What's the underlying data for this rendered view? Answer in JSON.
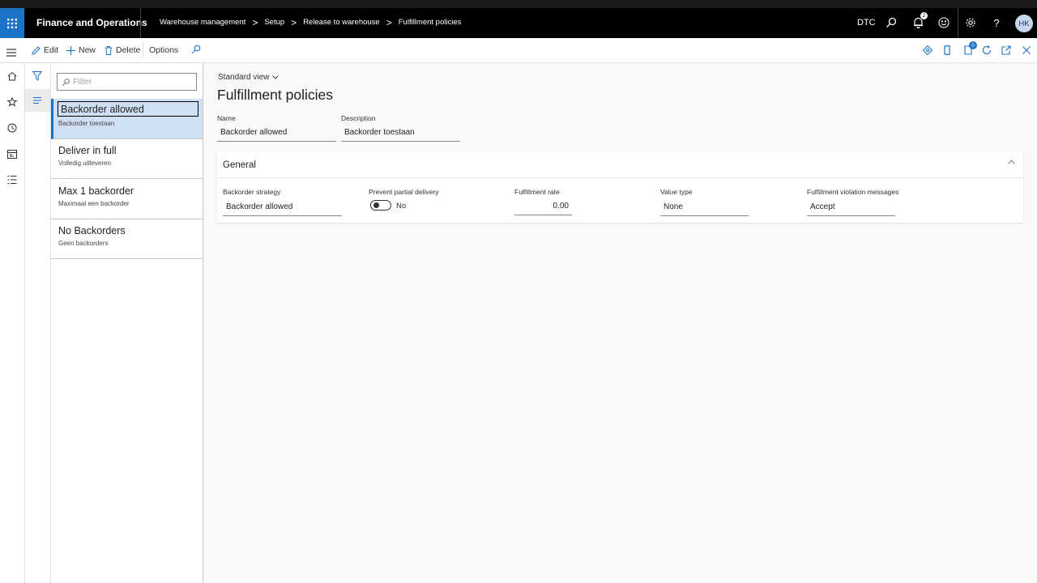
{
  "navbar": {
    "app_title": "Finance and Operations",
    "breadcrumb": [
      "Warehouse management",
      "Setup",
      "Release to warehouse",
      "Fulfillment policies"
    ],
    "breadcrumb_sep": ">",
    "company": "DTC",
    "notifications_count": "2",
    "avatar_initials": "HK",
    "help": "?"
  },
  "actionpane": {
    "edit": "Edit",
    "new": "New",
    "delete": "Delete",
    "options": "Options",
    "badge_count": "0"
  },
  "list": {
    "filter_placeholder": "Filter",
    "items": [
      {
        "title": "Backorder allowed",
        "subtitle": "Backorder toestaan"
      },
      {
        "title": "Deliver in full",
        "subtitle": "Volledig uitleveren"
      },
      {
        "title": "Max 1 backorder",
        "subtitle": "Maximaal een backorder"
      },
      {
        "title": "No Backorders",
        "subtitle": "Geen backorders"
      }
    ]
  },
  "form": {
    "view": "Standard view",
    "title": "Fulfillment policies",
    "name_label": "Name",
    "name_value": "Backorder allowed",
    "description_label": "Description",
    "description_value": "Backorder toestaan",
    "general": {
      "title": "General",
      "backorder_strategy_label": "Backorder strategy",
      "backorder_strategy_value": "Backorder allowed",
      "prevent_partial_label": "Prevent partial delivery",
      "prevent_partial_value": "No",
      "fulfillment_rate_label": "Fulfillment rate",
      "fulfillment_rate_value": "0.00",
      "value_type_label": "Value type",
      "value_type_value": "None",
      "violation_label": "Fulfillment violation messages",
      "violation_value": "Accept"
    }
  },
  "colors": {
    "accent": "#1a73c9",
    "navbar": "#000000",
    "selected_row": "#cfe0f5"
  }
}
